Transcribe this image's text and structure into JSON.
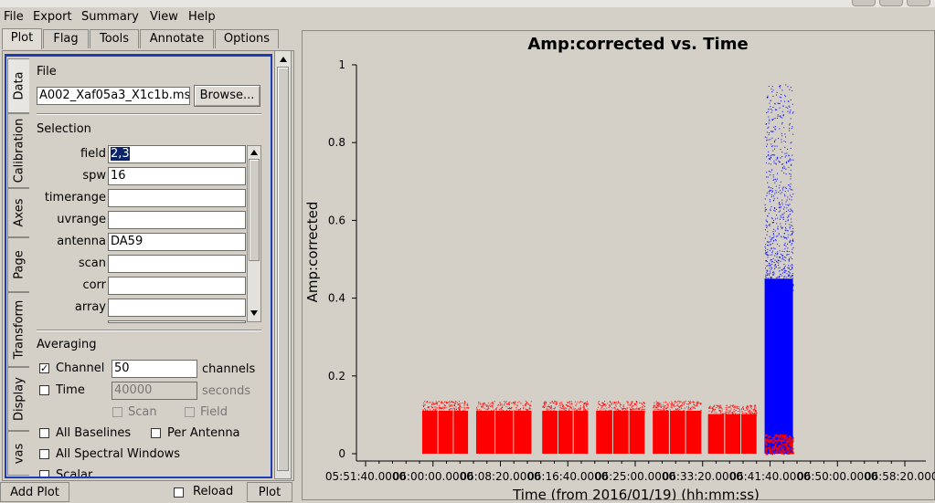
{
  "menu": {
    "file": "File",
    "export": "Export",
    "summary": "Summary",
    "view": "View",
    "help": "Help"
  },
  "tabs": [
    "Plot",
    "Flag",
    "Tools",
    "Annotate",
    "Options"
  ],
  "side_tabs": [
    "Data",
    "Calibration",
    "Axes",
    "Page",
    "Transform",
    "Display",
    "vas"
  ],
  "file_section": {
    "heading": "File",
    "filename": "A002_Xaf05a3_X1c1b.ms",
    "browse": "Browse..."
  },
  "selection": {
    "heading": "Selection",
    "fields": [
      {
        "label": "field",
        "value": "2,3"
      },
      {
        "label": "spw",
        "value": "16"
      },
      {
        "label": "timerange",
        "value": ""
      },
      {
        "label": "uvrange",
        "value": ""
      },
      {
        "label": "antenna",
        "value": "DA59"
      },
      {
        "label": "scan",
        "value": ""
      },
      {
        "label": "corr",
        "value": ""
      },
      {
        "label": "array",
        "value": ""
      }
    ]
  },
  "averaging": {
    "heading": "Averaging",
    "channel_label": "Channel",
    "channel_value": "50",
    "channel_unit": "channels",
    "time_label": "Time",
    "time_value": "40000",
    "time_unit": "seconds",
    "scan_label": "Scan",
    "field_label": "Field",
    "all_baselines": "All Baselines",
    "per_antenna": "Per Antenna",
    "all_spw": "All Spectral Windows",
    "scalar": "Scalar"
  },
  "bottom": {
    "add_plot": "Add Plot",
    "reload": "Reload",
    "plot": "Plot"
  },
  "colors": {
    "red_points": "#ff0000",
    "blue_points": "#0000ff",
    "tab_border": "#1d3cb5"
  },
  "chart_data": {
    "type": "scatter",
    "title": "Amp:corrected vs. Time",
    "xlabel": "Time (from 2016/01/19) (hh:mm:ss)",
    "ylabel": "Amp:corrected",
    "ylim": [
      0,
      1
    ],
    "yticks": [
      "0",
      "0.2",
      "0.4",
      "0.6",
      "0.8",
      "1"
    ],
    "xticks": [
      "05:51:40.0000",
      "06:00:00.0000",
      "06:08:20.0000",
      "06:16:40.0000",
      "06:25:00.0000",
      "06:33:20.0000",
      "06:41:40.0000",
      "06:50:00.0000",
      "06:58:20.0000"
    ],
    "series": [
      {
        "color": "red",
        "scans": [
          {
            "start": "05:58:40",
            "end": "06:04:20",
            "amp_min": 0.0,
            "amp_max": 0.13
          },
          {
            "start": "06:05:20",
            "end": "06:12:10",
            "amp_min": 0.0,
            "amp_max": 0.13
          },
          {
            "start": "06:13:30",
            "end": "06:19:10",
            "amp_min": 0.0,
            "amp_max": 0.13
          },
          {
            "start": "06:20:10",
            "end": "06:26:10",
            "amp_min": 0.0,
            "amp_max": 0.13
          },
          {
            "start": "06:27:10",
            "end": "06:33:10",
            "amp_min": 0.0,
            "amp_max": 0.13
          },
          {
            "start": "06:34:00",
            "end": "06:40:00",
            "amp_min": 0.0,
            "amp_max": 0.12
          },
          {
            "start": "06:41:00",
            "end": "06:44:30",
            "amp_min": 0.0,
            "amp_max": 0.05
          }
        ]
      },
      {
        "color": "blue",
        "scans": [
          {
            "start": "06:41:00",
            "end": "06:44:30",
            "amp_min": 0.0,
            "amp_max": 0.95
          }
        ]
      }
    ]
  }
}
